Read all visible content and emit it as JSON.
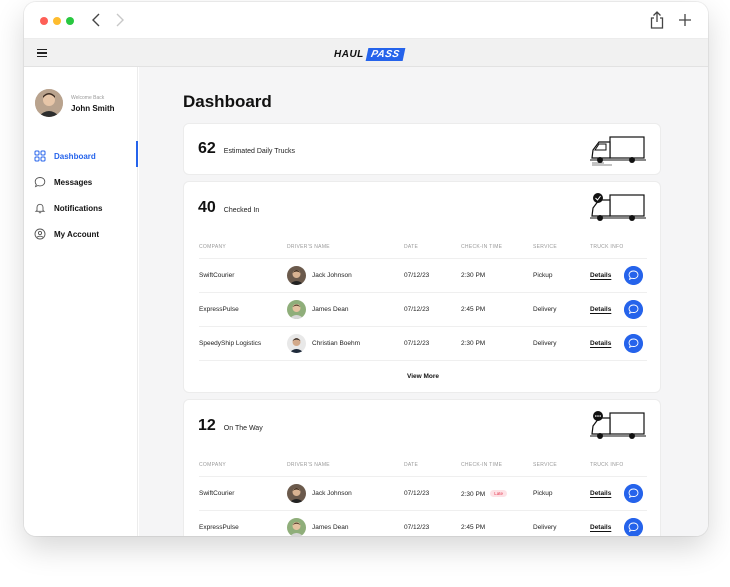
{
  "sidebar": {
    "welcome": "Welcome Back",
    "user_name": "John Smith",
    "items": [
      {
        "label": "Dashboard",
        "icon": "grid-icon",
        "active": true
      },
      {
        "label": "Messages",
        "icon": "message-icon"
      },
      {
        "label": "Notifications",
        "icon": "bell-icon"
      },
      {
        "label": "My Account",
        "icon": "account-icon"
      }
    ]
  },
  "app": {
    "logo_part1": "HAUL",
    "logo_part2": "PASS"
  },
  "main": {
    "title": "Dashboard"
  },
  "estimated": {
    "count": "62",
    "caption": "Estimated Daily Trucks"
  },
  "checked_in": {
    "count": "40",
    "caption": "Checked In",
    "columns": [
      "COMPANY",
      "DRIVER'S NAME",
      "DATE",
      "CHECK-IN TIME",
      "SERVICE",
      "TRUCK INFO"
    ],
    "rows": [
      {
        "company": "SwiftCourier",
        "driver": "Jack Johnson",
        "date": "07/12/23",
        "time": "2:30 PM",
        "service": "Pickup",
        "details": "Details"
      },
      {
        "company": "ExpressPulse",
        "driver": "James Dean",
        "date": "07/12/23",
        "time": "2:45 PM",
        "service": "Delivery",
        "details": "Details"
      },
      {
        "company": "SpeedyShip Logistics",
        "driver": "Christian Boehm",
        "date": "07/12/23",
        "time": "2:30 PM",
        "service": "Delivery",
        "details": "Details"
      }
    ],
    "view_more": "View More"
  },
  "on_the_way": {
    "count": "12",
    "caption": "On The Way",
    "columns": [
      "COMPANY",
      "DRIVER'S NAME",
      "DATE",
      "CHECK-IN TIME",
      "SERVICE",
      "TRUCK INFO"
    ],
    "rows": [
      {
        "company": "SwiftCourier",
        "driver": "Jack Johnson",
        "date": "07/12/23",
        "time": "2:30 PM",
        "badge": "Late",
        "service": "Pickup",
        "details": "Details"
      },
      {
        "company": "ExpressPulse",
        "driver": "James Dean",
        "date": "07/12/23",
        "time": "2:45 PM",
        "service": "Delivery",
        "details": "Details"
      }
    ]
  },
  "colors": {
    "accent": "#2563eb",
    "late_text": "#e53950",
    "late_bg": "#fde2e6"
  }
}
